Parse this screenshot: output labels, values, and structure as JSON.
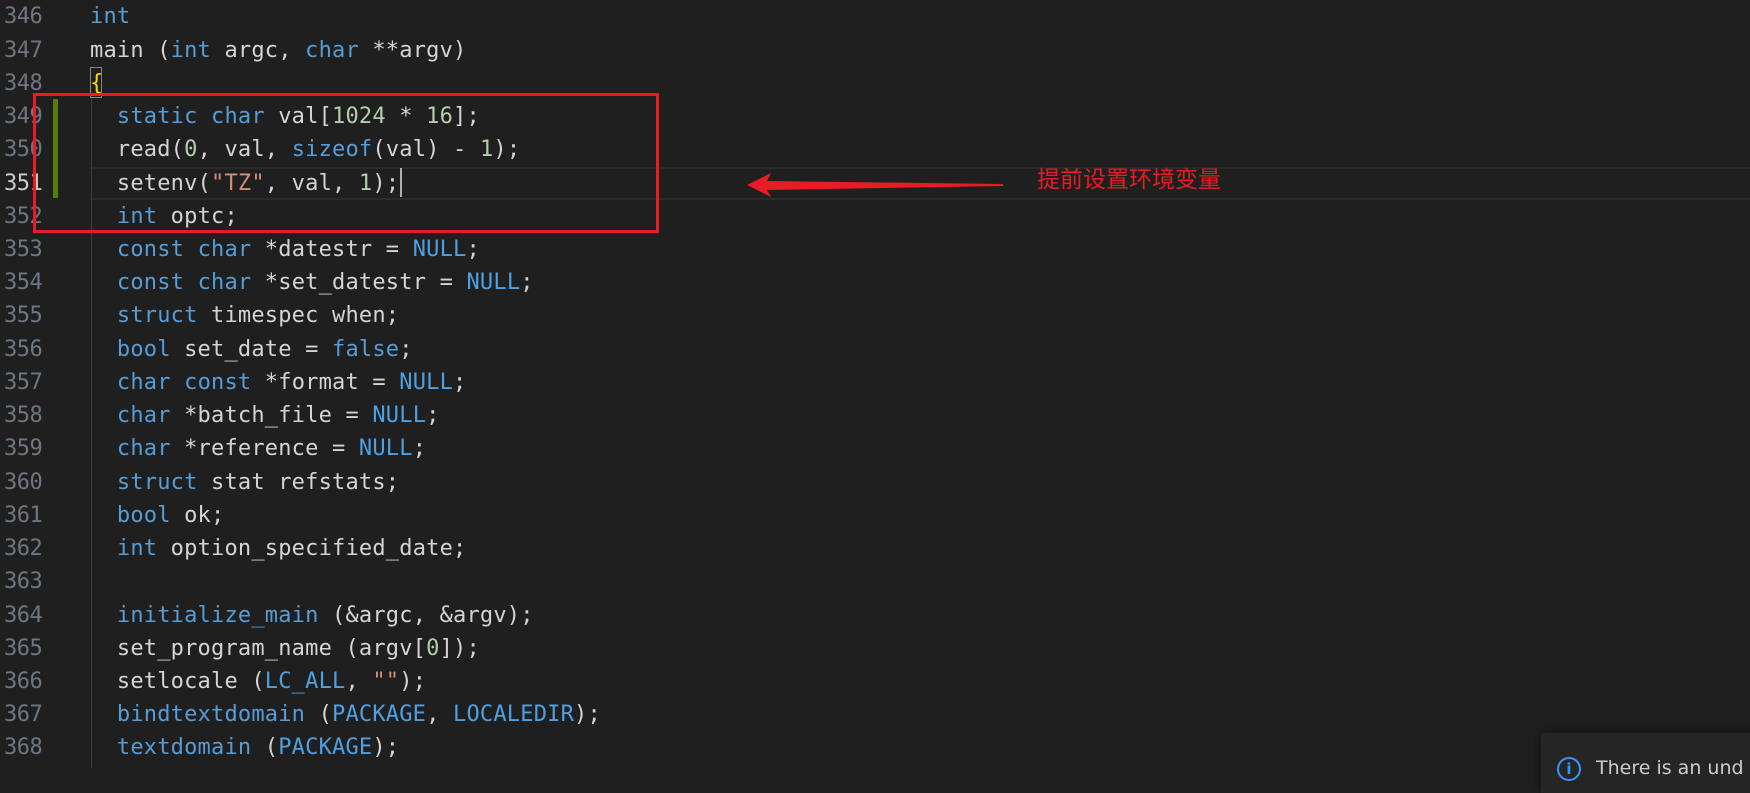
{
  "editor": {
    "current_line": 351,
    "lines": [
      {
        "n": "346",
        "tokens": [
          [
            "kw",
            "int"
          ]
        ]
      },
      {
        "n": "347",
        "tokens": [
          [
            "plain",
            "main ("
          ],
          [
            "kw",
            "int"
          ],
          [
            "plain",
            " argc, "
          ],
          [
            "kw",
            "char"
          ],
          [
            "plain",
            " **argv)"
          ]
        ]
      },
      {
        "n": "348",
        "tokens": [
          [
            "brace",
            "{"
          ]
        ]
      },
      {
        "n": "349",
        "tokens": [
          [
            "plain",
            "  "
          ],
          [
            "kw",
            "static"
          ],
          [
            "plain",
            " "
          ],
          [
            "kw",
            "char"
          ],
          [
            "plain",
            " val["
          ],
          [
            "num",
            "1024"
          ],
          [
            "plain",
            " * "
          ],
          [
            "num",
            "16"
          ],
          [
            "plain",
            "];"
          ]
        ]
      },
      {
        "n": "350",
        "tokens": [
          [
            "plain",
            "  read("
          ],
          [
            "num",
            "0"
          ],
          [
            "plain",
            ", val, "
          ],
          [
            "kw",
            "sizeof"
          ],
          [
            "plain",
            "(val) - "
          ],
          [
            "num",
            "1"
          ],
          [
            "plain",
            ");"
          ]
        ]
      },
      {
        "n": "351",
        "tokens": [
          [
            "plain",
            "  setenv("
          ],
          [
            "str",
            "\"TZ\""
          ],
          [
            "plain",
            ", val, "
          ],
          [
            "num",
            "1"
          ],
          [
            "plain",
            ");"
          ]
        ]
      },
      {
        "n": "352",
        "tokens": [
          [
            "plain",
            "  "
          ],
          [
            "kw",
            "int"
          ],
          [
            "plain",
            " optc;"
          ]
        ]
      },
      {
        "n": "353",
        "tokens": [
          [
            "plain",
            "  "
          ],
          [
            "kw",
            "const"
          ],
          [
            "plain",
            " "
          ],
          [
            "kw",
            "char"
          ],
          [
            "plain",
            " *datestr = "
          ],
          [
            "macro",
            "NULL"
          ],
          [
            "plain",
            ";"
          ]
        ]
      },
      {
        "n": "354",
        "tokens": [
          [
            "plain",
            "  "
          ],
          [
            "kw",
            "const"
          ],
          [
            "plain",
            " "
          ],
          [
            "kw",
            "char"
          ],
          [
            "plain",
            " *set_datestr = "
          ],
          [
            "macro",
            "NULL"
          ],
          [
            "plain",
            ";"
          ]
        ]
      },
      {
        "n": "355",
        "tokens": [
          [
            "plain",
            "  "
          ],
          [
            "kw",
            "struct"
          ],
          [
            "plain",
            " timespec when;"
          ]
        ]
      },
      {
        "n": "356",
        "tokens": [
          [
            "plain",
            "  "
          ],
          [
            "kw",
            "bool"
          ],
          [
            "plain",
            " set_date = "
          ],
          [
            "kw",
            "false"
          ],
          [
            "plain",
            ";"
          ]
        ]
      },
      {
        "n": "357",
        "tokens": [
          [
            "plain",
            "  "
          ],
          [
            "kw",
            "char"
          ],
          [
            "plain",
            " "
          ],
          [
            "kw",
            "const"
          ],
          [
            "plain",
            " *format = "
          ],
          [
            "macro",
            "NULL"
          ],
          [
            "plain",
            ";"
          ]
        ]
      },
      {
        "n": "358",
        "tokens": [
          [
            "plain",
            "  "
          ],
          [
            "kw",
            "char"
          ],
          [
            "plain",
            " *batch_file = "
          ],
          [
            "macro",
            "NULL"
          ],
          [
            "plain",
            ";"
          ]
        ]
      },
      {
        "n": "359",
        "tokens": [
          [
            "plain",
            "  "
          ],
          [
            "kw",
            "char"
          ],
          [
            "plain",
            " *reference = "
          ],
          [
            "macro",
            "NULL"
          ],
          [
            "plain",
            ";"
          ]
        ]
      },
      {
        "n": "360",
        "tokens": [
          [
            "plain",
            "  "
          ],
          [
            "kw",
            "struct"
          ],
          [
            "plain",
            " stat refstats;"
          ]
        ]
      },
      {
        "n": "361",
        "tokens": [
          [
            "plain",
            "  "
          ],
          [
            "kw",
            "bool"
          ],
          [
            "plain",
            " ok;"
          ]
        ]
      },
      {
        "n": "362",
        "tokens": [
          [
            "plain",
            "  "
          ],
          [
            "kw",
            "int"
          ],
          [
            "plain",
            " option_specified_date;"
          ]
        ]
      },
      {
        "n": "363",
        "tokens": []
      },
      {
        "n": "364",
        "tokens": [
          [
            "plain",
            "  "
          ],
          [
            "fn",
            "initialize_main"
          ],
          [
            "plain",
            " (&argc, &argv);"
          ]
        ]
      },
      {
        "n": "365",
        "tokens": [
          [
            "plain",
            "  set_program_name (argv["
          ],
          [
            "num",
            "0"
          ],
          [
            "plain",
            "]);"
          ]
        ]
      },
      {
        "n": "366",
        "tokens": [
          [
            "plain",
            "  setlocale ("
          ],
          [
            "macro",
            "LC_ALL"
          ],
          [
            "plain",
            ", "
          ],
          [
            "str",
            "\"\""
          ],
          [
            "plain",
            ");"
          ]
        ]
      },
      {
        "n": "367",
        "tokens": [
          [
            "plain",
            "  "
          ],
          [
            "fn",
            "bindtextdomain"
          ],
          [
            "plain",
            " ("
          ],
          [
            "macro",
            "PACKAGE"
          ],
          [
            "plain",
            ", "
          ],
          [
            "macro",
            "LOCALEDIR"
          ],
          [
            "plain",
            ");"
          ]
        ]
      },
      {
        "n": "368",
        "tokens": [
          [
            "plain",
            "  "
          ],
          [
            "fn",
            "textdomain"
          ],
          [
            "plain",
            " ("
          ],
          [
            "macro",
            "PACKAGE"
          ],
          [
            "plain",
            ");"
          ]
        ]
      }
    ]
  },
  "annotation": {
    "text": "提前设置环境变量",
    "color": "#e81c24"
  },
  "notification": {
    "icon": "info-icon",
    "icon_glyph": "i",
    "text": "There is an und"
  },
  "colors": {
    "background": "#1f1f1f",
    "keyword": "#569cd6",
    "number": "#b5cea8",
    "string": "#ce9178",
    "git_modified": "#587c0c",
    "annotation_red": "#e81c24"
  }
}
